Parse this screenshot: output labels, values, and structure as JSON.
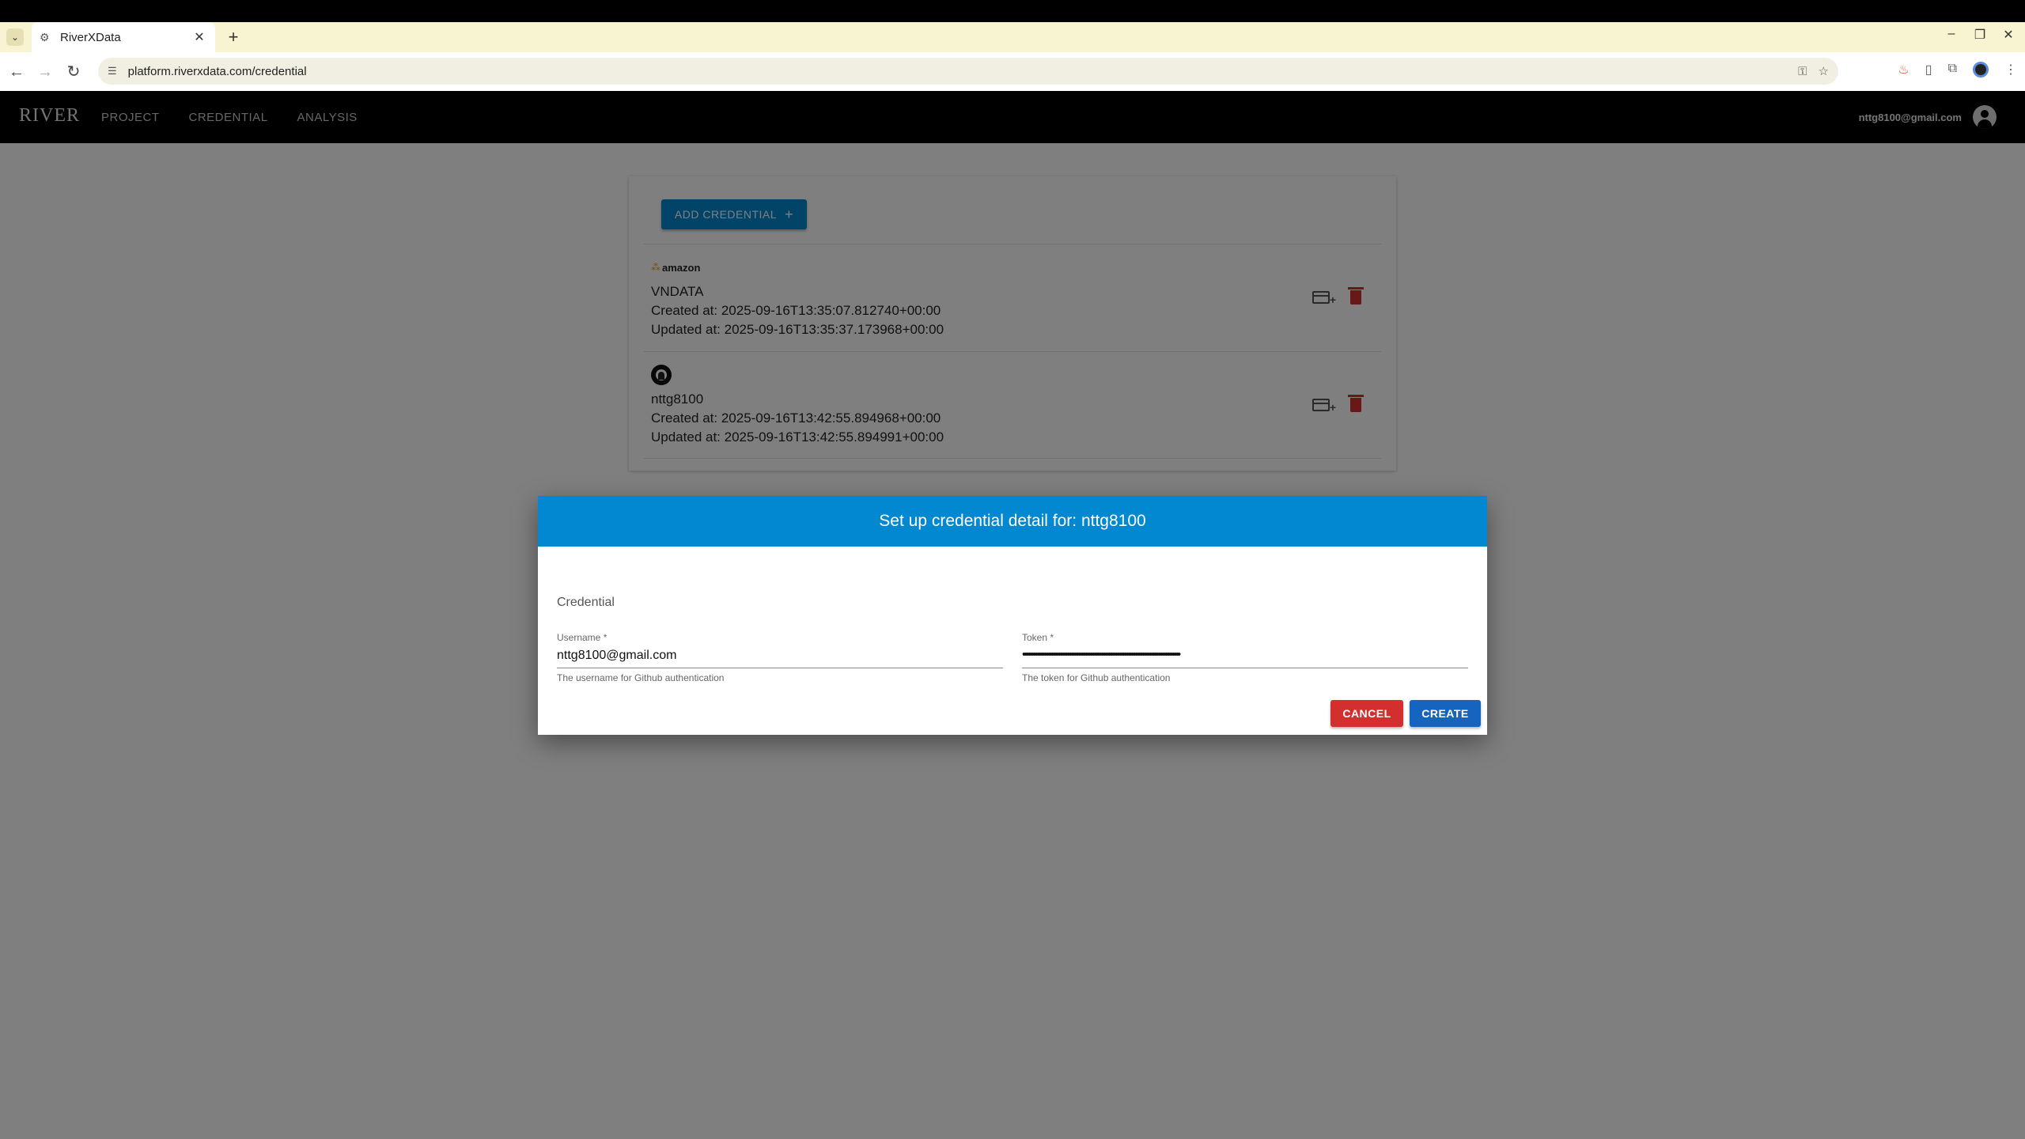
{
  "browser": {
    "tab_title": "RiverXData",
    "url": "platform.riverxdata.com/credential"
  },
  "app": {
    "logo": "RIVER",
    "nav": [
      "PROJECT",
      "CREDENTIAL",
      "ANALYSIS"
    ],
    "user_email": "nttg8100@gmail.com"
  },
  "credentials": {
    "add_button_label": "ADD CREDENTIAL",
    "items": [
      {
        "provider_logo_text": "amazon",
        "name": "VNDATA",
        "created": "Created at: 2025-09-16T13:35:07.812740+00:00",
        "updated": "Updated at: 2025-09-16T13:35:37.173968+00:00"
      },
      {
        "name": "nttg8100",
        "created": "Created at: 2025-09-16T13:42:55.894968+00:00",
        "updated": "Updated at: 2025-09-16T13:42:55.894991+00:00"
      }
    ]
  },
  "dialog": {
    "title": "Set up credential detail for: nttg8100",
    "section": "Credential",
    "username": {
      "label": "Username *",
      "value": "nttg8100@gmail.com",
      "help": "The username for Github authentication"
    },
    "token": {
      "label": "Token *",
      "value": "••••••••••••••••••••••••••••••••••••••••••••••••••••••••••••••••••••••••••••••••••••••••",
      "help": "The token for Github authentication"
    },
    "cancel_label": "CANCEL",
    "create_label": "CREATE"
  },
  "colors": {
    "primary": "#0288d1",
    "danger": "#d32f2f",
    "create": "#1565c0"
  }
}
